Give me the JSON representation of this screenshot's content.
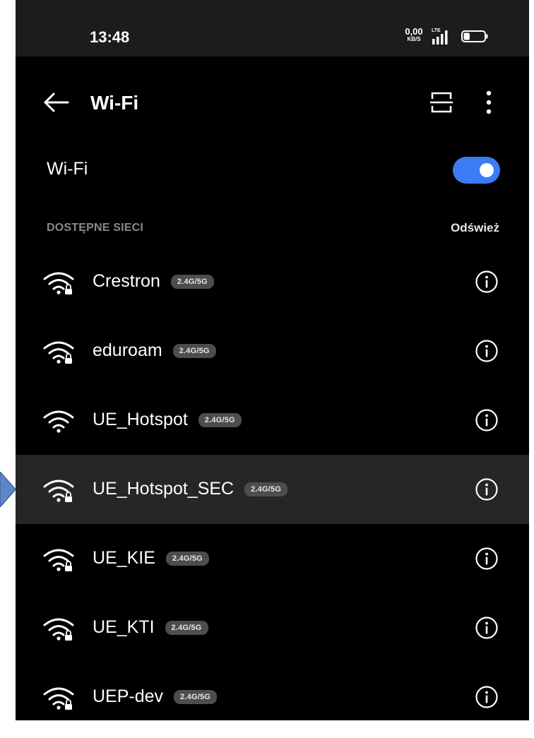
{
  "status_bar": {
    "time": "13:48",
    "net_speed_value": "0,00",
    "net_speed_unit": "KB/S",
    "network_type": "LTE",
    "battery_level": 0.3
  },
  "app_bar": {
    "title": "Wi-Fi",
    "back_icon": "arrow-left-icon",
    "scan_icon": "qr-scan-icon",
    "menu_icon": "more-vertical-icon"
  },
  "wifi_toggle": {
    "label": "Wi-Fi",
    "state": "on",
    "color": "#3b7cf5"
  },
  "networks_section": {
    "title": "DOSTĘPNE SIECI",
    "refresh_label": "Odśwież"
  },
  "networks": [
    {
      "name": "Crestron",
      "band": "2.4G/5G",
      "secured": true,
      "selected": false
    },
    {
      "name": "eduroam",
      "band": "2.4G/5G",
      "secured": true,
      "selected": false
    },
    {
      "name": "UE_Hotspot",
      "band": "2.4G/5G",
      "secured": false,
      "selected": false
    },
    {
      "name": "UE_Hotspot_SEC",
      "band": "2.4G/5G",
      "secured": true,
      "selected": true
    },
    {
      "name": "UE_KIE",
      "band": "2.4G/5G",
      "secured": true,
      "selected": false
    },
    {
      "name": "UE_KTI",
      "band": "2.4G/5G",
      "secured": true,
      "selected": false
    },
    {
      "name": "UEP-dev",
      "band": "2.4G/5G",
      "secured": true,
      "selected": false
    }
  ],
  "colors": {
    "background": "#000000",
    "status_bar": "#1c1c1c",
    "selected_row": "#262626",
    "badge": "#4d4d4d",
    "accent": "#3b7cf5",
    "pointer": "#5b87c9"
  }
}
